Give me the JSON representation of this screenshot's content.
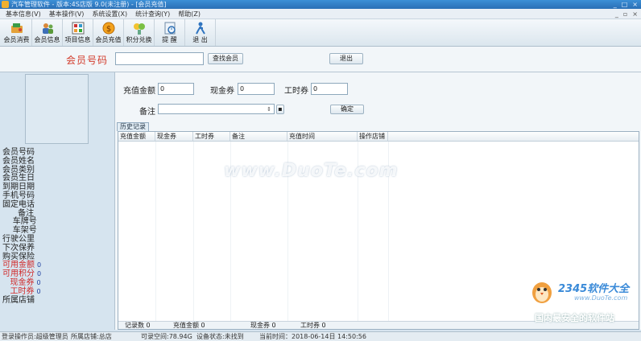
{
  "window": {
    "title": "汽车管理软件 - 版本:4S店版 9.0(未注册) - [会员充值]",
    "controls": [
      "_",
      "□",
      "×"
    ]
  },
  "menu": {
    "items": [
      "基本信息(V)",
      "基本操作(V)",
      "系统设置(X)",
      "统计查询(Y)",
      "帮助(Z)"
    ],
    "right_controls": [
      "_",
      "▫",
      "×"
    ]
  },
  "toolbar": {
    "buttons": [
      {
        "label": "会员消费",
        "icon": "member-consume-icon"
      },
      {
        "label": "会员信息",
        "icon": "member-info-icon"
      },
      {
        "label": "项目信息",
        "icon": "project-info-icon"
      },
      {
        "label": "会员充值",
        "icon": "member-recharge-icon"
      },
      {
        "label": "积分兑换",
        "icon": "points-exchange-icon"
      },
      {
        "label": "提 醒",
        "icon": "reminder-icon"
      },
      {
        "label": "退 出",
        "icon": "exit-icon"
      }
    ]
  },
  "top_form": {
    "member_no_label": "会员号码",
    "member_no_value": "",
    "find_button": "查找会员",
    "exit_button": "退出"
  },
  "recharge": {
    "amount_label": "充值金额",
    "amount_value": "0",
    "cash_coupon_label": "现金券",
    "cash_coupon_value": "0",
    "labor_coupon_label": "工时券",
    "labor_coupon_value": "0",
    "remark_label": "备注",
    "remark_value": "",
    "small_button": "▪",
    "confirm_button": "确定"
  },
  "member_info": {
    "fields": [
      {
        "label": "会员号码",
        "red": false,
        "value": ""
      },
      {
        "label": "会员姓名",
        "red": false,
        "value": ""
      },
      {
        "label": "会员类别",
        "red": false,
        "value": ""
      },
      {
        "label": "会员生日",
        "red": false,
        "value": ""
      },
      {
        "label": "到期日期",
        "red": false,
        "value": ""
      },
      {
        "label": "手机号码",
        "red": false,
        "value": ""
      },
      {
        "label": "固定电话",
        "red": false,
        "value": ""
      },
      {
        "label": "      备注",
        "red": false,
        "value": ""
      },
      {
        "label": "    车牌号",
        "red": false,
        "value": ""
      },
      {
        "label": "    车架号",
        "red": false,
        "value": ""
      },
      {
        "label": "行驶公里",
        "red": false,
        "value": ""
      },
      {
        "label": "下次保养",
        "red": false,
        "value": ""
      },
      {
        "label": "购买保险",
        "red": false,
        "value": ""
      },
      {
        "label": "可用金额",
        "red": true,
        "value": "0"
      },
      {
        "label": "可用积分",
        "red": true,
        "value": "0"
      },
      {
        "label": "   现金券",
        "red": true,
        "value": "0"
      },
      {
        "label": "   工时券",
        "red": true,
        "value": "0"
      },
      {
        "label": "所属店铺",
        "red": false,
        "value": ""
      }
    ]
  },
  "history": {
    "tab_label": "历史记录",
    "columns": [
      "充值金额",
      "现金券",
      "工时券",
      "备注",
      "充值时间",
      "操作店铺"
    ],
    "rows": [],
    "footer": {
      "records": "记录数 0",
      "amount": "充值金额 0",
      "cash": "现金券 0",
      "labor": "工时券 0"
    }
  },
  "status": {
    "login": "登录操作员:超级管理员",
    "store": "所属店铺:总店",
    "space": "可录空间:78.94G",
    "device": "设备状态:未找到",
    "time": "当前时间：2018-06-14日 14:50:56"
  },
  "watermarks": {
    "main": "www.DuoTe.com",
    "brand": "2345软件大全",
    "url": "www.DuoTe.com",
    "slogan": "国内最安全的软件站"
  },
  "colors": {
    "accent_red": "#d23a2a",
    "panel_bg": "#d6e4ef",
    "form_bg": "#f2f6f9"
  }
}
